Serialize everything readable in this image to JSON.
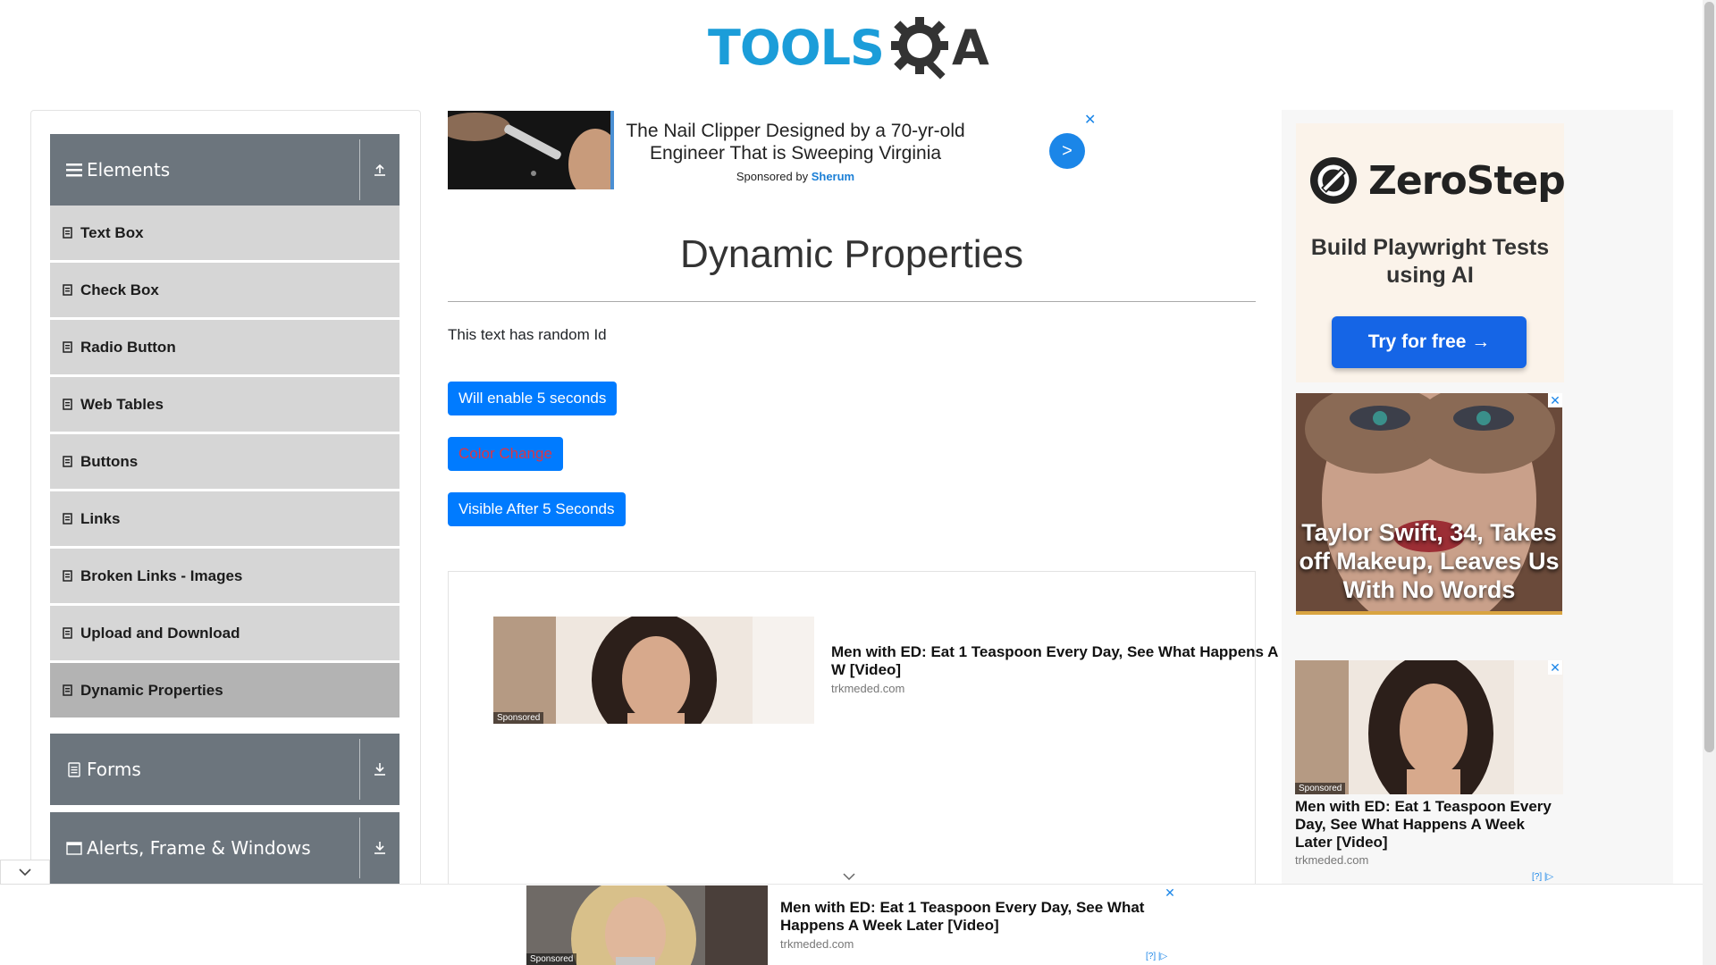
{
  "header": {
    "logo_text": "TOOLS",
    "logo_suffix": "A",
    "logo_icon": "gear-magnifier-icon"
  },
  "sidebar": {
    "groups": [
      {
        "label": "Elements",
        "icon": "hamburger-icon",
        "toggle": "collapse-up-icon"
      },
      {
        "label": "Forms",
        "icon": "document-icon",
        "toggle": "expand-down-icon"
      },
      {
        "label": "Alerts, Frame & Windows",
        "icon": "window-icon",
        "toggle": "expand-down-icon"
      }
    ],
    "items": [
      {
        "label": "Text Box"
      },
      {
        "label": "Check Box"
      },
      {
        "label": "Radio Button"
      },
      {
        "label": "Web Tables"
      },
      {
        "label": "Buttons"
      },
      {
        "label": "Links"
      },
      {
        "label": "Broken Links - Images"
      },
      {
        "label": "Upload and Download"
      },
      {
        "label": "Dynamic Properties",
        "active": true
      }
    ]
  },
  "top_ad": {
    "headline": "The Nail Clipper Designed by a 70-yr-old Engineer That is Sweeping Virginia",
    "sponsored_prefix": "Sponsored by",
    "sponsor": "Sherum",
    "go_label": ">",
    "close_label": "✕"
  },
  "main": {
    "title": "Dynamic Properties",
    "random_text": "This text has random Id",
    "buttons": {
      "enable_after": "Will enable 5 seconds",
      "color_change": "Color Change",
      "visible_after": "Visible After 5 Seconds"
    }
  },
  "mid_ad": {
    "sponsored": "Sponsored",
    "headline": "Men with ED: Eat 1 Teaspoon Every Day, See What Happens A W [Video]",
    "domain": "trkmeded.com"
  },
  "right_ads": {
    "zerostep": {
      "name": "ZeroStep",
      "tagline": "Build Playwright Tests using AI",
      "cta": "Try for free →"
    },
    "celebrity": {
      "headline": "Taylor Swift, 34, Takes off Makeup, Leaves Us With No Words",
      "close_label": "✕"
    },
    "ed": {
      "sponsored": "Sponsored",
      "headline": "Men with ED: Eat 1 Teaspoon Every Day, See What Happens A Week Later [Video]",
      "domain": "trkmeded.com",
      "close_label": "✕",
      "adchoice": "[?] |▷"
    }
  },
  "bottom_ad": {
    "sponsored": "Sponsored",
    "headline": "Men with ED: Eat 1 Teaspoon Every Day, See What Happens A Week Later [Video]",
    "domain": "trkmeded.com",
    "close_label": "✕",
    "adchoice": "[?] |▷"
  },
  "colors": {
    "primary": "#007bff",
    "sidebar_header": "#6c757d",
    "sidebar_item": "#d6d6d6",
    "sidebar_active": "#b3b3b3",
    "logo_blue": "#1b9dd9"
  }
}
